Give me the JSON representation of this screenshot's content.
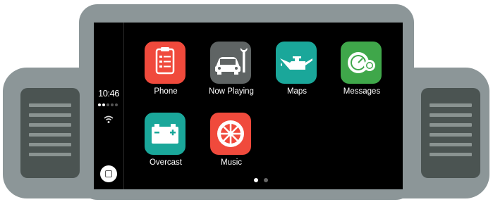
{
  "status": {
    "time": "10:46",
    "signal_bars_filled": 2,
    "signal_bars_total": 5,
    "icons": [
      "signal-icon",
      "wifi-icon",
      "home-button-icon"
    ]
  },
  "apps": [
    {
      "label": "Phone",
      "icon": "clipboard-icon",
      "color": "#f04a3c"
    },
    {
      "label": "Now Playing",
      "icon": "car-wrench-icon",
      "color": "#5f6464"
    },
    {
      "label": "Maps",
      "icon": "oil-can-icon",
      "color": "#1aa79a"
    },
    {
      "label": "Messages",
      "icon": "speedometer-icon",
      "color": "#3fa74a"
    },
    {
      "label": "Overcast",
      "icon": "battery-icon",
      "color": "#1aa79a"
    },
    {
      "label": "Music",
      "icon": "wheel-icon",
      "color": "#f04a3c"
    }
  ],
  "pager": {
    "pages": 2,
    "current": 1
  },
  "colors": {
    "housing": "#8c9698",
    "vent": "#4b5452",
    "screen": "#000000"
  }
}
